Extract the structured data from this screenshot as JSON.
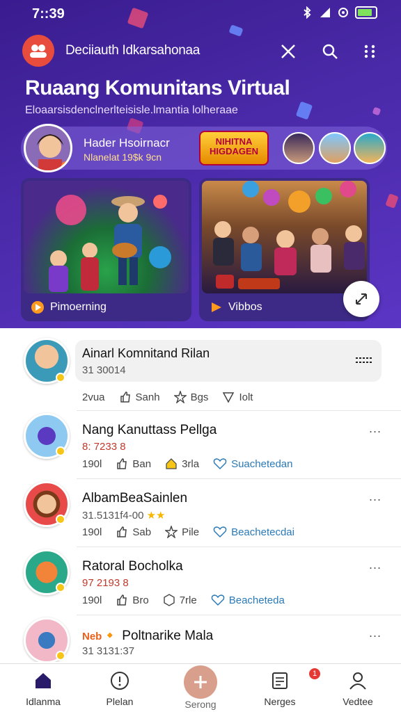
{
  "status_bar": {
    "time": "7::39"
  },
  "app_bar": {
    "app_name": "Deciiauth Idkarsahonaa"
  },
  "hero": {
    "title": "Ruaang Komunitans Virtual",
    "subtitle": "Eloaarsisdenclnerlteisisle.lmantia lolheraae",
    "banner": {
      "name": "Hader Hsoirnacr",
      "meta": "Nlanelat 19$k 9cn",
      "badge": "NIHITNA HIGDAGEN"
    },
    "cards": [
      {
        "label": "Pimoerning"
      },
      {
        "label": "Vibbos"
      }
    ]
  },
  "feed": [
    {
      "title": "Ainarl Komnitand Rilan",
      "sub": "31 30014",
      "actions": [
        "2vua",
        "Sanh",
        "Bgs",
        "Iolt"
      ],
      "more": "..."
    },
    {
      "title": "Nang Kanuttass Pellga",
      "sub": "8: 7233 8",
      "actions": [
        "190l",
        "Ban",
        "3rla",
        "Suachetedan"
      ],
      "more": "..."
    },
    {
      "title": "AlbamBeaSainlen",
      "sub": "31.5131f4-00",
      "actions": [
        "190l",
        "Sab",
        "Pile",
        "Beachetecdai"
      ],
      "more": "..."
    },
    {
      "title": "Ratoral Bocholka",
      "sub": "97 2193 8",
      "actions": [
        "190l",
        "Bro",
        "7rle",
        "Beacheteda"
      ],
      "more": "..."
    },
    {
      "title": "Poltnarike Mala",
      "sub": "31 3131:37",
      "badge": "Neb",
      "more": "..."
    }
  ],
  "tabs": [
    {
      "label": "Idlanma"
    },
    {
      "label": "Plelan"
    },
    {
      "label": "Serong"
    },
    {
      "label": "Nerges",
      "badge": "1"
    },
    {
      "label": "Vedtee"
    }
  ],
  "colors": {
    "hero_bg": "#4a2aa8",
    "accent_red": "#e74c3c",
    "link_blue": "#2a7ab8"
  }
}
